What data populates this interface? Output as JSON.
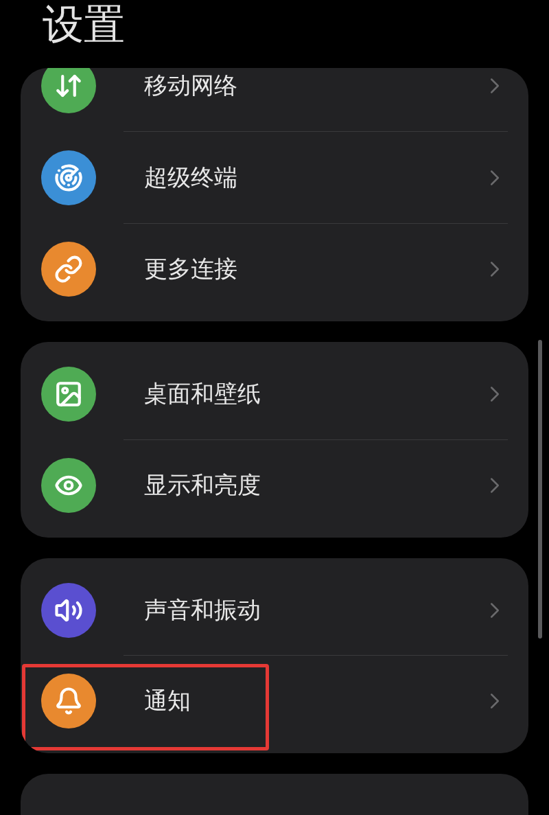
{
  "title": "设置",
  "groups": [
    {
      "items": [
        {
          "label": "移动网络",
          "color": "#4fab54",
          "highlighted": false
        },
        {
          "label": "超级终端",
          "color": "#3b8fd6",
          "highlighted": false
        },
        {
          "label": "更多连接",
          "color": "#e8892f",
          "highlighted": false
        }
      ]
    },
    {
      "items": [
        {
          "label": "桌面和壁纸",
          "color": "#4fab54",
          "highlighted": false
        },
        {
          "label": "显示和亮度",
          "color": "#4fab54",
          "highlighted": false
        }
      ]
    },
    {
      "items": [
        {
          "label": "声音和振动",
          "color": "#5a4fd0",
          "highlighted": false
        },
        {
          "label": "通知",
          "color": "#e8892f",
          "highlighted": true
        }
      ]
    }
  ]
}
